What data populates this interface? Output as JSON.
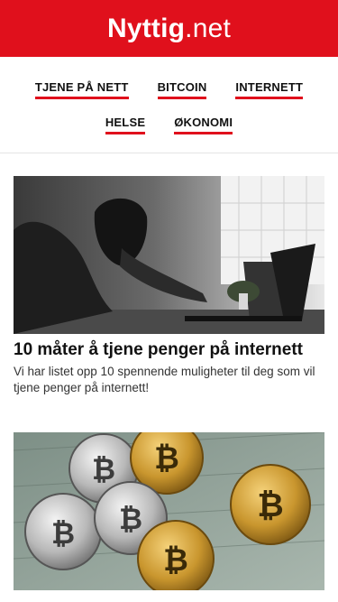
{
  "site": {
    "name_bold": "Nyttig",
    "name_tld": ".net"
  },
  "nav": {
    "row1": [
      {
        "label": "TJENE PÅ NETT"
      },
      {
        "label": "BITCOIN"
      },
      {
        "label": "INTERNETT"
      }
    ],
    "row2": [
      {
        "label": "HELSE"
      },
      {
        "label": "ØKONOMI"
      }
    ]
  },
  "posts": [
    {
      "title": "10 måter å tjene penger på internett",
      "excerpt": "Vi har listet opp 10 spennende muligheter til deg som vil tjene penger på internett!",
      "image": "woman-at-laptop-photo"
    },
    {
      "title": "",
      "excerpt": "",
      "image": "bitcoin-coins-on-dollar-bills-photo"
    }
  ],
  "colors": {
    "brand": "#e0101c"
  }
}
